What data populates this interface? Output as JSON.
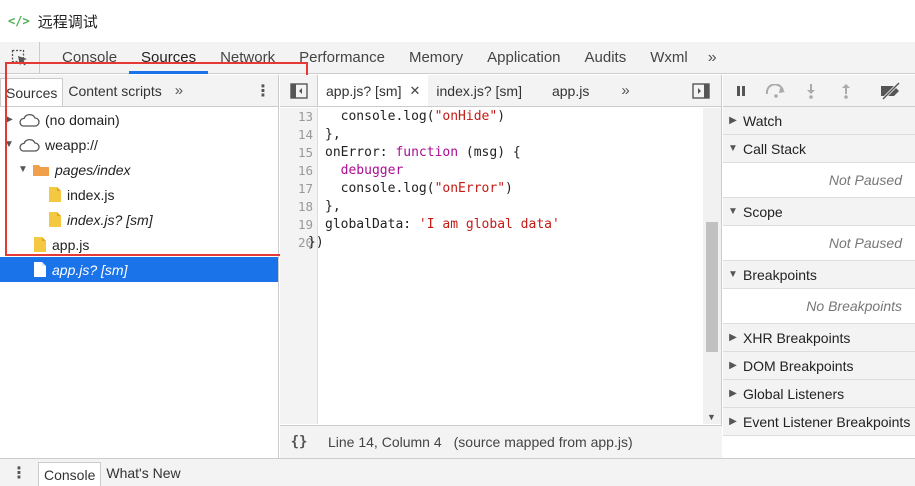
{
  "window": {
    "logo": "</>",
    "title": "远程调试"
  },
  "main_tabs": [
    "Console",
    "Sources",
    "Network",
    "Performance",
    "Memory",
    "Application",
    "Audits",
    "Wxml"
  ],
  "main_more": "»",
  "navigator": {
    "tabs": [
      "Sources",
      "Content scripts"
    ],
    "more": "»",
    "kebab": "⋮",
    "tree": [
      {
        "label": "(no domain)",
        "arrow": "▶"
      },
      {
        "label": "weapp://",
        "arrow": "▼"
      },
      {
        "label": "pages/index",
        "arrow": "▼"
      },
      {
        "label": "index.js"
      },
      {
        "label": "index.js? [sm]"
      },
      {
        "label": "app.js"
      },
      {
        "label": "app.js? [sm]"
      }
    ]
  },
  "editor": {
    "tabs": [
      {
        "label": "app.js? [sm]",
        "close": "✕"
      },
      {
        "label": "index.js? [sm]"
      },
      {
        "label": "app.js"
      }
    ],
    "more": "»",
    "line_numbers": [
      "13",
      "14",
      "15",
      "16",
      "17",
      "18",
      "19",
      "20"
    ],
    "code": {
      "l13_a": "  console.log(",
      "l13_s": "\"onHide\"",
      "l13_b": ")",
      "l14": "},",
      "l15_a": "onError: ",
      "l15_k": "function",
      "l15_b": " (msg) {",
      "l16_k": "  debugger",
      "l17_a": "  console.log(",
      "l17_s": "\"onError\"",
      "l17_b": ")",
      "l18": "},",
      "l19_a": "globalData: ",
      "l19_s": "'I am global data'",
      "l20": "})"
    },
    "status": {
      "braces": "{}",
      "position": "Line 14, Column 4",
      "mapped": "(source mapped from app.js)"
    }
  },
  "debugger": {
    "panes": {
      "watch": "Watch",
      "call_stack": "Call Stack",
      "call_stack_empty": "Not Paused",
      "scope": "Scope",
      "scope_empty": "Not Paused",
      "breakpoints": "Breakpoints",
      "breakpoints_empty": "No Breakpoints",
      "xhr": "XHR Breakpoints",
      "dom": "DOM Breakpoints",
      "global": "Global Listeners",
      "event": "Event Listener Breakpoints"
    },
    "tri_collapsed": "▶",
    "tri_expanded": "▼"
  },
  "drawer": {
    "kebab": "⋮",
    "tabs": [
      "Console",
      "What's New"
    ]
  },
  "colors": {
    "accent": "#1a73e8",
    "highlight_box": "#e53935",
    "folder": "#f0a04b",
    "file": "#f5c842"
  }
}
